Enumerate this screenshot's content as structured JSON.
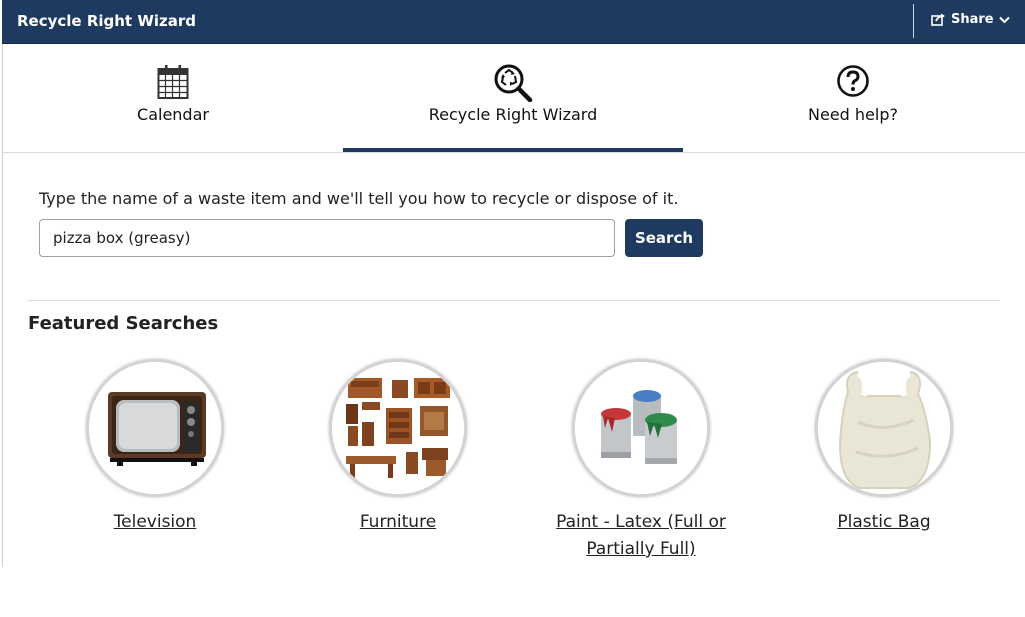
{
  "header": {
    "title": "Recycle Right Wizard",
    "share_label": "Share",
    "background_color": "#1f3a60"
  },
  "tabs": [
    {
      "label": "Calendar",
      "icon": "calendar-icon",
      "active": false
    },
    {
      "label": "Recycle Right Wizard",
      "icon": "recycle-search-icon",
      "active": true
    },
    {
      "label": "Need help?",
      "icon": "question-circle-icon",
      "active": false
    }
  ],
  "search": {
    "prompt": "Type the name of a waste item and we'll tell you how to recycle or dispose of it.",
    "value": "pizza box (greasy)",
    "button_label": "Search"
  },
  "featured": {
    "title": "Featured Searches",
    "items": [
      {
        "label": "Television",
        "image": "television-image"
      },
      {
        "label": "Furniture",
        "image": "furniture-image"
      },
      {
        "label": "Paint - Latex (Full or Partially Full)",
        "image": "paint-cans-image"
      },
      {
        "label": "Plastic Bag",
        "image": "plastic-bag-image"
      }
    ]
  }
}
